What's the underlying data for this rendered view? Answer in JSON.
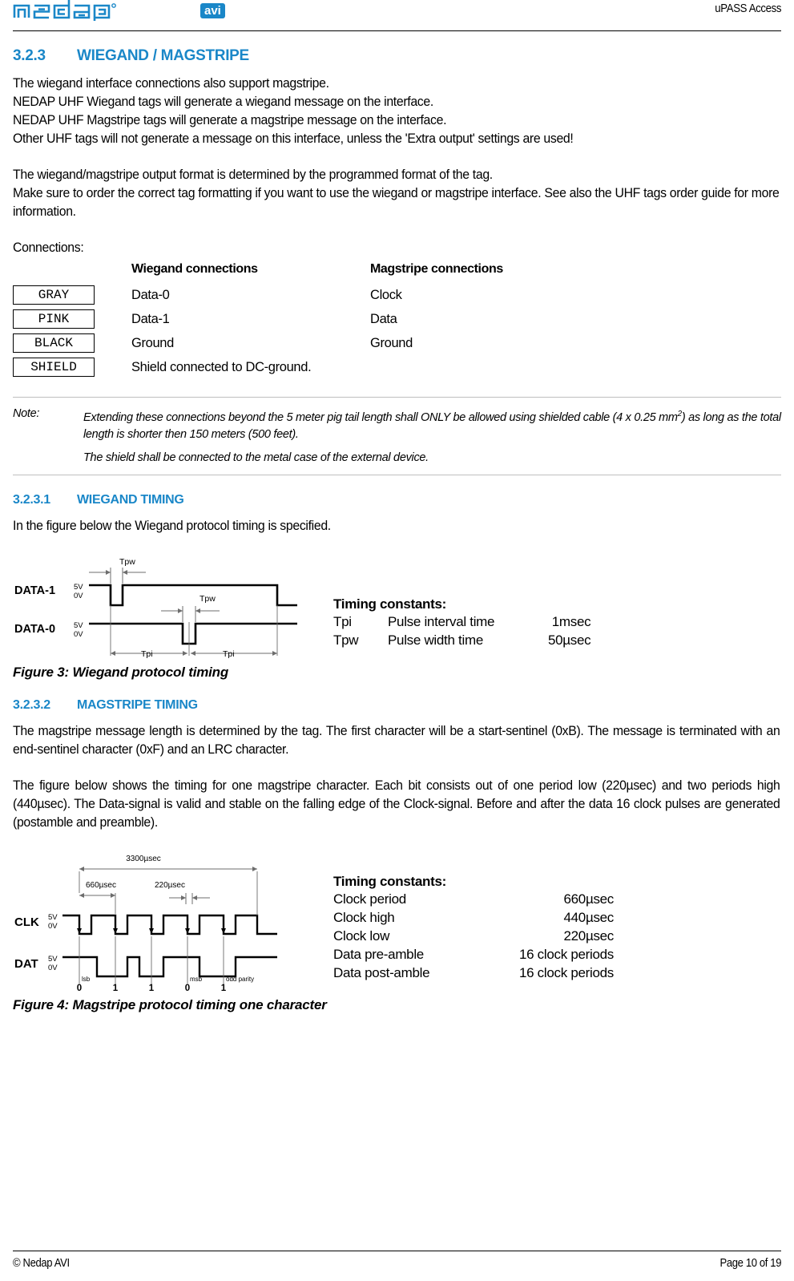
{
  "header": {
    "logo_text": "nedap",
    "logo_badge": "avi",
    "product_title": "uPASS Access",
    "brand_color": "#1a87c8"
  },
  "sections": {
    "wiegand_magstripe": {
      "number": "3.2.3",
      "title": "WIEGAND / MAGSTRIPE",
      "paragraph1": [
        "The wiegand interface connections also support magstripe.",
        "NEDAP UHF Wiegand tags will generate a wiegand message on the interface.",
        "NEDAP UHF Magstripe tags will generate a magstripe message on the interface.",
        "Other UHF tags will not generate a message on this interface, unless the 'Extra output' settings are used!"
      ],
      "paragraph2": [
        "The wiegand/magstripe output format is determined by the programmed format of the tag.",
        "Make sure to order the correct tag formatting if you want to use the wiegand or magstripe interface. See also the UHF tags order guide for more information."
      ],
      "connections_label": "Connections:",
      "table": {
        "headers": [
          "",
          "Wiegand connections",
          "Magstripe connections"
        ],
        "rows": [
          {
            "wire": "GRAY",
            "wiegand": "Data-0",
            "magstripe": "Clock"
          },
          {
            "wire": "PINK",
            "wiegand": "Data-1",
            "magstripe": "Data"
          },
          {
            "wire": "BLACK",
            "wiegand": "Ground",
            "magstripe": "Ground"
          },
          {
            "wire": "SHIELD",
            "wiegand": "Shield connected to DC-ground.",
            "magstripe": ""
          }
        ]
      },
      "note": {
        "label": "Note:",
        "line1_a": "Extending these connections beyond the 5 meter pig tail length shall ONLY be allowed using shielded cable (4 x 0.25 mm",
        "line1_sup": "2",
        "line1_b": ") as long as the total length is shorter then 150 meters (500 feet).",
        "line2": "The shield shall be connected to the metal case of the external device."
      }
    },
    "wiegand_timing": {
      "number": "3.2.3.1",
      "title": "WIEGAND TIMING",
      "intro": "In the figure below the Wiegand protocol timing is specified.",
      "caption": "Figure 3: Wiegand protocol timing",
      "diagram": {
        "signal_labels": [
          "DATA-1",
          "DATA-0"
        ],
        "level_high": "5V",
        "level_low": "0V",
        "annotations": [
          "Tpw",
          "Tpw",
          "Tpi",
          "Tpi"
        ]
      },
      "constants": {
        "title": "Timing constants:",
        "rows": [
          {
            "symbol": "Tpi",
            "description": "Pulse interval time",
            "value": "1msec"
          },
          {
            "symbol": "Tpw",
            "description": "Pulse width time",
            "value": "50µsec"
          }
        ]
      }
    },
    "magstripe_timing": {
      "number": "3.2.3.2",
      "title": "MAGSTRIPE TIMING",
      "paragraph1": "The magstripe message length is determined by the tag. The first character will be a start-sentinel (0xB). The message is terminated with an end-sentinel character (0xF) and an LRC character.",
      "paragraph2": "The figure below shows the timing for one magstripe character. Each bit consists out of one period low (220µsec) and two periods high (440µsec). The Data-signal is valid and stable on the falling edge of the Clock-signal. Before and after the data 16 clock pulses are generated (postamble and preamble).",
      "caption": "Figure 4: Magstripe protocol timing one character",
      "diagram": {
        "signal_labels": [
          "CLK",
          "DAT"
        ],
        "level_high": "5V",
        "level_low": "0V",
        "span_total": "3300µsec",
        "span_period": "660µsec",
        "span_low": "220µsec",
        "bit_labels": [
          "lsb",
          "",
          "",
          "msb",
          "odd parity"
        ],
        "bit_values": [
          "0",
          "1",
          "1",
          "0",
          "1"
        ]
      },
      "constants": {
        "title": "Timing constants:",
        "rows": [
          {
            "description": "Clock period",
            "value": "660µsec"
          },
          {
            "description": "Clock high",
            "value": "440µsec"
          },
          {
            "description": "Clock low",
            "value": "220µsec"
          },
          {
            "description": "Data pre-amble",
            "value": "16 clock periods"
          },
          {
            "description": "Data post-amble",
            "value": "16 clock periods"
          }
        ]
      }
    }
  },
  "footer": {
    "copyright": "© Nedap AVI",
    "page": "Page 10 of 19"
  }
}
